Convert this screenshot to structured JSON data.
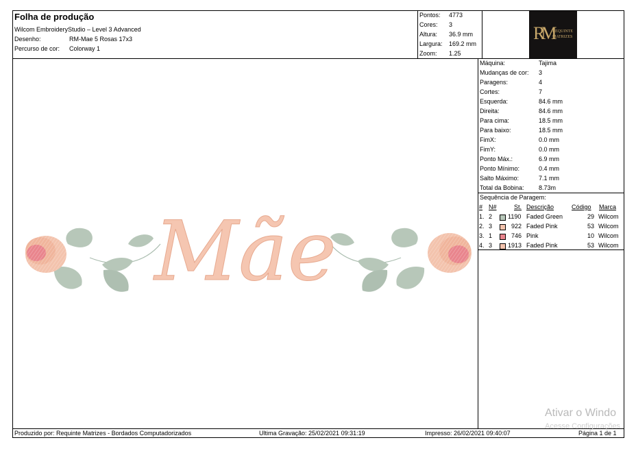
{
  "header": {
    "title": "Folha de produção",
    "software": "Wilcom EmbroideryStudio – Level 3 Advanced",
    "design_label": "Desenho:",
    "design_value": "RM-Mae 5 Rosas 17x3",
    "colorway_label": "Percurso de cor:",
    "colorway_value": "Colorway 1"
  },
  "summary": [
    {
      "label": "Pontos:",
      "value": "4773"
    },
    {
      "label": "Cores:",
      "value": "3"
    },
    {
      "label": "Altura:",
      "value": "36.9 mm"
    },
    {
      "label": "Largura:",
      "value": "169.2 mm"
    },
    {
      "label": "Zoom:",
      "value": "1.25"
    }
  ],
  "logo": {
    "monogram": "RM",
    "line1": "REQUINTE",
    "line2": "MATRIZES",
    "color": "#c9a86a"
  },
  "design_text": "Mãe",
  "details": [
    {
      "label": "Máquina:",
      "value": "Tajima"
    },
    {
      "label": "Mudanças de cor:",
      "value": "3"
    },
    {
      "label": "Paragens:",
      "value": "4"
    },
    {
      "label": "Cortes:",
      "value": "7"
    },
    {
      "label": "Esquerda:",
      "value": "84.6 mm"
    },
    {
      "label": "Direita:",
      "value": "84.6 mm"
    },
    {
      "label": "Para cima:",
      "value": "18.5 mm"
    },
    {
      "label": "Para baixo:",
      "value": "18.5 mm"
    },
    {
      "label": "FimX:",
      "value": "0.0 mm"
    },
    {
      "label": "FimY:",
      "value": "0.0 mm"
    },
    {
      "label": "Ponto Máx.:",
      "value": "6.9 mm"
    },
    {
      "label": "Ponto Mínimo:",
      "value": "0.4 mm"
    },
    {
      "label": "Salto Máximo:",
      "value": "7.1 mm"
    },
    {
      "label": "Total da Bobina:",
      "value": "8.73m"
    }
  ],
  "sequence": {
    "title": "Sequência de Paragem:",
    "headers": {
      "num": "#",
      "n": "N#",
      "st": "St.",
      "desc": "Descrição",
      "code": "Código",
      "brand": "Marca"
    },
    "rows": [
      {
        "num": "1.",
        "n": "2",
        "st": "1190",
        "desc": "Faded Green",
        "code": "29",
        "brand": "Wilcom",
        "color": "#b7c7b9"
      },
      {
        "num": "2.",
        "n": "3",
        "st": "922",
        "desc": "Faded Pink",
        "code": "53",
        "brand": "Wilcom",
        "color": "#f3c3ad"
      },
      {
        "num": "3.",
        "n": "1",
        "st": "746",
        "desc": "Pink",
        "code": "10",
        "brand": "Wilcom",
        "color": "#e9858d"
      },
      {
        "num": "4.",
        "n": "3",
        "st": "1913",
        "desc": "Faded Pink",
        "code": "53",
        "brand": "Wilcom",
        "color": "#f3c3ad"
      }
    ]
  },
  "footer": {
    "produced_by": "Produzido por: Requinte Matrizes - Bordados Computadorizados",
    "last_saved": "Ultima Gravação: 25/02/2021 09:31:19",
    "printed": "Impresso: 26/02/2021 09:40:07",
    "page": "Página 1 de 1"
  },
  "watermark": {
    "line1": "Ativar o Windo",
    "line2": "Acesse Configurações"
  }
}
